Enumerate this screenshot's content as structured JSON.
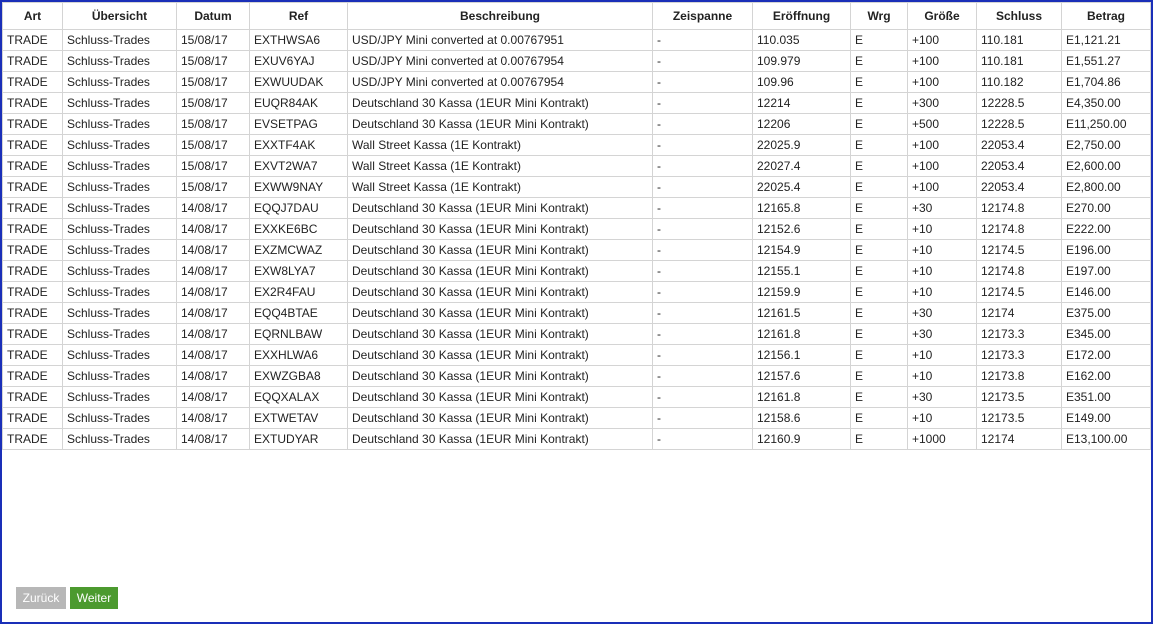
{
  "table": {
    "headers": [
      "Art",
      "Übersicht",
      "Datum",
      "Ref",
      "Beschreibung",
      "Zeispanne",
      "Eröffnung",
      "Wrg",
      "Größe",
      "Schluss",
      "Betrag"
    ],
    "rows": [
      [
        "TRADE",
        "Schluss-Trades",
        "15/08/17",
        "EXTHWSA6",
        "USD/JPY Mini converted at 0.00767951",
        "-",
        "110.035",
        "E",
        "+100",
        "110.181",
        "E1,121.21"
      ],
      [
        "TRADE",
        "Schluss-Trades",
        "15/08/17",
        "EXUV6YAJ",
        "USD/JPY Mini converted at 0.00767954",
        "-",
        "109.979",
        "E",
        "+100",
        "110.181",
        "E1,551.27"
      ],
      [
        "TRADE",
        "Schluss-Trades",
        "15/08/17",
        "EXWUUDAK",
        "USD/JPY Mini converted at 0.00767954",
        "-",
        "109.96",
        "E",
        "+100",
        "110.182",
        "E1,704.86"
      ],
      [
        "TRADE",
        "Schluss-Trades",
        "15/08/17",
        "EUQR84AK",
        "Deutschland 30 Kassa (1EUR Mini Kontrakt)",
        "-",
        "12214",
        "E",
        "+300",
        "12228.5",
        "E4,350.00"
      ],
      [
        "TRADE",
        "Schluss-Trades",
        "15/08/17",
        "EVSETPAG",
        "Deutschland 30 Kassa (1EUR Mini Kontrakt)",
        "-",
        "12206",
        "E",
        "+500",
        "12228.5",
        "E11,250.00"
      ],
      [
        "TRADE",
        "Schluss-Trades",
        "15/08/17",
        "EXXTF4AK",
        "Wall Street Kassa (1E Kontrakt)",
        "-",
        "22025.9",
        "E",
        "+100",
        "22053.4",
        "E2,750.00"
      ],
      [
        "TRADE",
        "Schluss-Trades",
        "15/08/17",
        "EXVT2WA7",
        "Wall Street Kassa (1E Kontrakt)",
        "-",
        "22027.4",
        "E",
        "+100",
        "22053.4",
        "E2,600.00"
      ],
      [
        "TRADE",
        "Schluss-Trades",
        "15/08/17",
        "EXWW9NAY",
        "Wall Street Kassa (1E Kontrakt)",
        "-",
        "22025.4",
        "E",
        "+100",
        "22053.4",
        "E2,800.00"
      ],
      [
        "TRADE",
        "Schluss-Trades",
        "14/08/17",
        "EQQJ7DAU",
        "Deutschland 30 Kassa (1EUR Mini Kontrakt)",
        "-",
        "12165.8",
        "E",
        "+30",
        "12174.8",
        "E270.00"
      ],
      [
        "TRADE",
        "Schluss-Trades",
        "14/08/17",
        "EXXKE6BC",
        "Deutschland 30 Kassa (1EUR Mini Kontrakt)",
        "-",
        "12152.6",
        "E",
        "+10",
        "12174.8",
        "E222.00"
      ],
      [
        "TRADE",
        "Schluss-Trades",
        "14/08/17",
        "EXZMCWAZ",
        "Deutschland 30 Kassa (1EUR Mini Kontrakt)",
        "-",
        "12154.9",
        "E",
        "+10",
        "12174.5",
        "E196.00"
      ],
      [
        "TRADE",
        "Schluss-Trades",
        "14/08/17",
        "EXW8LYA7",
        "Deutschland 30 Kassa (1EUR Mini Kontrakt)",
        "-",
        "12155.1",
        "E",
        "+10",
        "12174.8",
        "E197.00"
      ],
      [
        "TRADE",
        "Schluss-Trades",
        "14/08/17",
        "EX2R4FAU",
        "Deutschland 30 Kassa (1EUR Mini Kontrakt)",
        "-",
        "12159.9",
        "E",
        "+10",
        "12174.5",
        "E146.00"
      ],
      [
        "TRADE",
        "Schluss-Trades",
        "14/08/17",
        "EQQ4BTAE",
        "Deutschland 30 Kassa (1EUR Mini Kontrakt)",
        "-",
        "12161.5",
        "E",
        "+30",
        "12174",
        "E375.00"
      ],
      [
        "TRADE",
        "Schluss-Trades",
        "14/08/17",
        "EQRNLBAW",
        "Deutschland 30 Kassa (1EUR Mini Kontrakt)",
        "-",
        "12161.8",
        "E",
        "+30",
        "12173.3",
        "E345.00"
      ],
      [
        "TRADE",
        "Schluss-Trades",
        "14/08/17",
        "EXXHLWA6",
        "Deutschland 30 Kassa (1EUR Mini Kontrakt)",
        "-",
        "12156.1",
        "E",
        "+10",
        "12173.3",
        "E172.00"
      ],
      [
        "TRADE",
        "Schluss-Trades",
        "14/08/17",
        "EXWZGBA8",
        "Deutschland 30 Kassa (1EUR Mini Kontrakt)",
        "-",
        "12157.6",
        "E",
        "+10",
        "12173.8",
        "E162.00"
      ],
      [
        "TRADE",
        "Schluss-Trades",
        "14/08/17",
        "EQQXALAX",
        "Deutschland 30 Kassa (1EUR Mini Kontrakt)",
        "-",
        "12161.8",
        "E",
        "+30",
        "12173.5",
        "E351.00"
      ],
      [
        "TRADE",
        "Schluss-Trades",
        "14/08/17",
        "EXTWETAV",
        "Deutschland 30 Kassa (1EUR Mini Kontrakt)",
        "-",
        "12158.6",
        "E",
        "+10",
        "12173.5",
        "E149.00"
      ],
      [
        "TRADE",
        "Schluss-Trades",
        "14/08/17",
        "EXTUDYAR",
        "Deutschland 30 Kassa (1EUR Mini Kontrakt)",
        "-",
        "12160.9",
        "E",
        "+1000",
        "12174",
        "E13,100.00"
      ]
    ]
  },
  "pagination": {
    "back_label": "Zurück",
    "next_label": "Weiter"
  },
  "colors": {
    "frame_border": "#1a2fb8",
    "back_button": "#b7b7b7",
    "next_button": "#4c9a2f",
    "grid_line": "#d4d4d4"
  }
}
